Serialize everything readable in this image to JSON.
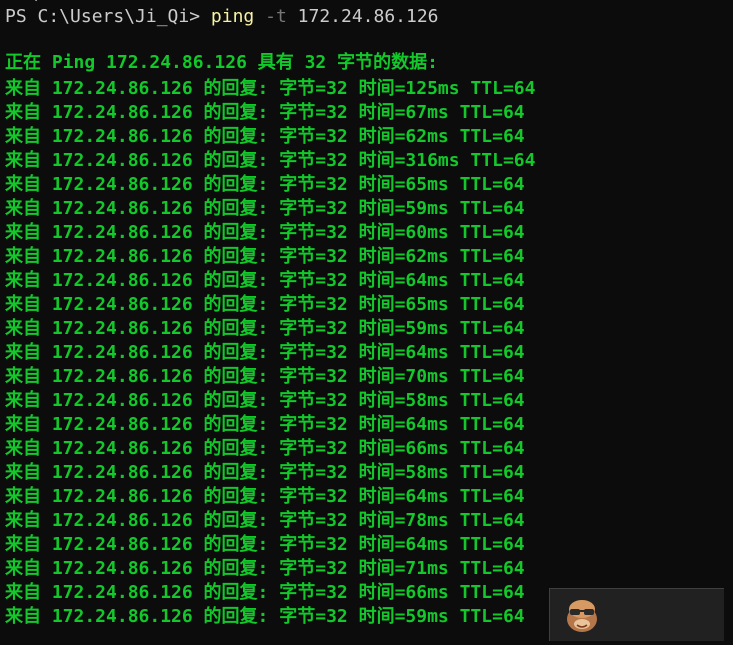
{
  "clipped_top_text": "  \\  ~  ~",
  "prompt": {
    "ps": "PS C:\\Users\\Ji_Qi> ",
    "command": "ping",
    "flag": "-t",
    "target": "172.24.86.126"
  },
  "header": "正在 Ping 172.24.86.126 具有 32 字节的数据:",
  "replies": [
    "来自 172.24.86.126 的回复: 字节=32 时间=125ms TTL=64",
    "来自 172.24.86.126 的回复: 字节=32 时间=67ms TTL=64",
    "来自 172.24.86.126 的回复: 字节=32 时间=62ms TTL=64",
    "来自 172.24.86.126 的回复: 字节=32 时间=316ms TTL=64",
    "来自 172.24.86.126 的回复: 字节=32 时间=65ms TTL=64",
    "来自 172.24.86.126 的回复: 字节=32 时间=59ms TTL=64",
    "来自 172.24.86.126 的回复: 字节=32 时间=60ms TTL=64",
    "来自 172.24.86.126 的回复: 字节=32 时间=62ms TTL=64",
    "来自 172.24.86.126 的回复: 字节=32 时间=64ms TTL=64",
    "来自 172.24.86.126 的回复: 字节=32 时间=65ms TTL=64",
    "来自 172.24.86.126 的回复: 字节=32 时间=59ms TTL=64",
    "来自 172.24.86.126 的回复: 字节=32 时间=64ms TTL=64",
    "来自 172.24.86.126 的回复: 字节=32 时间=70ms TTL=64",
    "来自 172.24.86.126 的回复: 字节=32 时间=58ms TTL=64",
    "来自 172.24.86.126 的回复: 字节=32 时间=64ms TTL=64",
    "来自 172.24.86.126 的回复: 字节=32 时间=66ms TTL=64",
    "来自 172.24.86.126 的回复: 字节=32 时间=58ms TTL=64",
    "来自 172.24.86.126 的回复: 字节=32 时间=64ms TTL=64",
    "来自 172.24.86.126 的回复: 字节=32 时间=78ms TTL=64",
    "来自 172.24.86.126 的回复: 字节=32 时间=64ms TTL=64",
    "来自 172.24.86.126 的回复: 字节=32 时间=71ms TTL=64",
    "来自 172.24.86.126 的回复: 字节=32 时间=66ms TTL=64",
    "来自 172.24.86.126 的回复: 字节=32 时间=59ms TTL=64"
  ],
  "colors": {
    "background": "#0c0c0c",
    "output_green": "#13c82a",
    "prompt_gray": "#cccccc",
    "command_yellow": "#f9f1a5",
    "flag_gray": "#767676"
  },
  "icons": {
    "watermark": "avatar-icon"
  }
}
